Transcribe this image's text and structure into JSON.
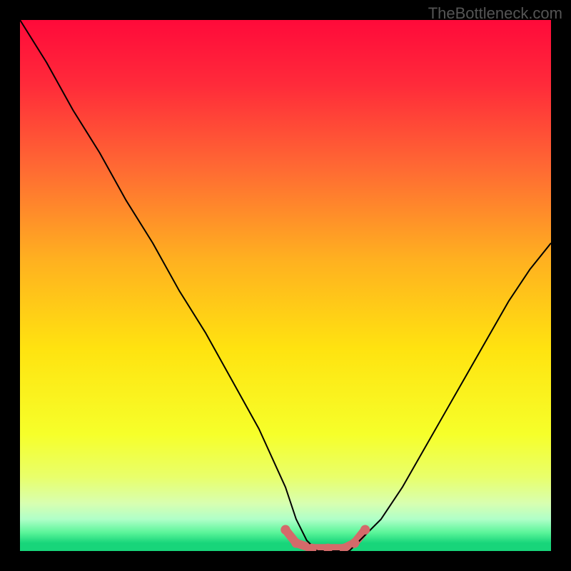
{
  "watermark": "TheBottleneck.com",
  "chart_data": {
    "type": "line",
    "title": "",
    "xlabel": "",
    "ylabel": "",
    "xlim": [
      0,
      100
    ],
    "ylim": [
      0,
      100
    ],
    "x": [
      0,
      5,
      10,
      15,
      20,
      25,
      30,
      35,
      40,
      45,
      50,
      52,
      54,
      56,
      58,
      60,
      62,
      64,
      68,
      72,
      76,
      80,
      84,
      88,
      92,
      96,
      100
    ],
    "values": [
      100,
      92,
      83,
      75,
      66,
      58,
      49,
      41,
      32,
      23,
      12,
      6,
      2,
      0,
      0,
      0,
      0,
      2,
      6,
      12,
      19,
      26,
      33,
      40,
      47,
      53,
      58
    ],
    "gradient_stops": [
      {
        "pos": 0.0,
        "color": "#ff0a3a"
      },
      {
        "pos": 0.12,
        "color": "#ff2a3a"
      },
      {
        "pos": 0.28,
        "color": "#ff6a33"
      },
      {
        "pos": 0.45,
        "color": "#ffb020"
      },
      {
        "pos": 0.62,
        "color": "#ffe310"
      },
      {
        "pos": 0.78,
        "color": "#f6ff2a"
      },
      {
        "pos": 0.86,
        "color": "#e9ff6a"
      },
      {
        "pos": 0.91,
        "color": "#d8ffb0"
      },
      {
        "pos": 0.94,
        "color": "#b0ffc8"
      },
      {
        "pos": 0.965,
        "color": "#5cf59a"
      },
      {
        "pos": 0.985,
        "color": "#18d57a"
      },
      {
        "pos": 1.0,
        "color": "#18d57a"
      }
    ],
    "trough_marker": {
      "color": "#d46a6a",
      "thickness_px": 12,
      "points": [
        {
          "x": 50,
          "y": 4
        },
        {
          "x": 52,
          "y": 1.5
        },
        {
          "x": 55,
          "y": 0.5
        },
        {
          "x": 58,
          "y": 0.5
        },
        {
          "x": 61,
          "y": 0.5
        },
        {
          "x": 63,
          "y": 1.5
        },
        {
          "x": 65,
          "y": 4
        }
      ]
    }
  }
}
